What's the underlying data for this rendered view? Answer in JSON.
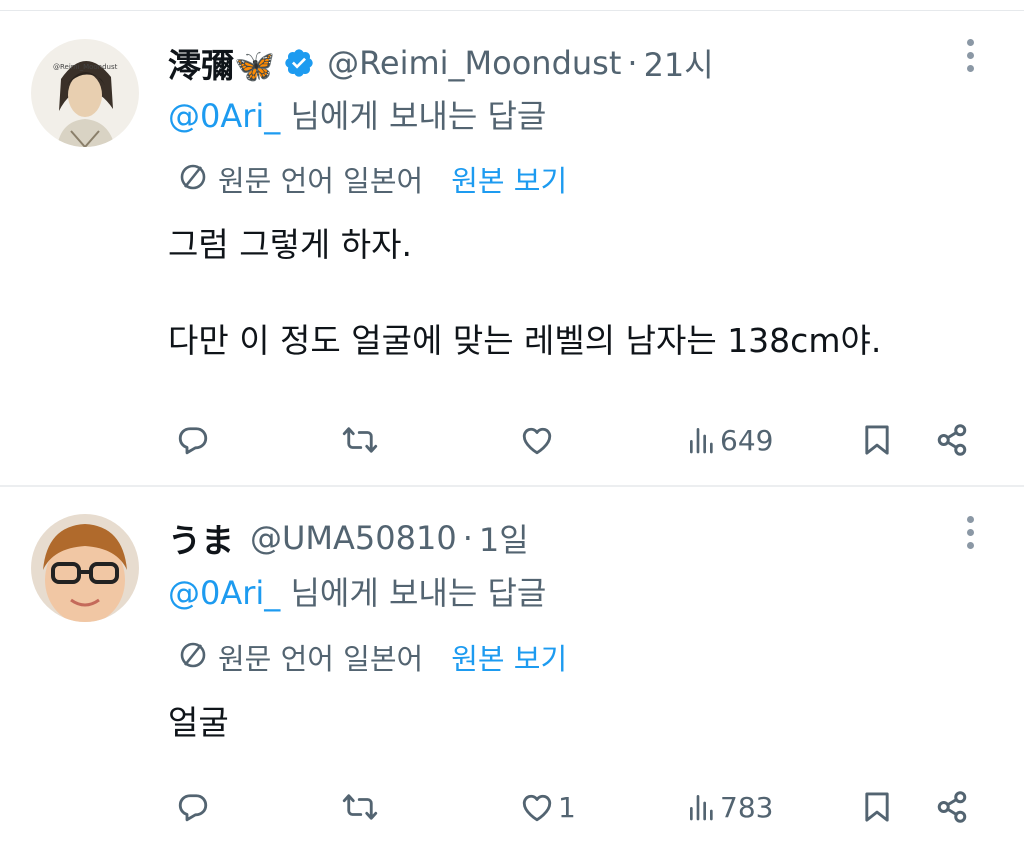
{
  "tweets": [
    {
      "name": "澪彌🦋",
      "handle": "@Reimi_Moondust",
      "time": "21시",
      "reply_mention": "@0Ari_",
      "reply_suffix": " 님에게 보내는 답글",
      "translate_note": "원문 언어 일본어",
      "translate_link": "원본 보기",
      "body": "그럼 그렇게 하자.\n\n다만 이 정도 얼굴에 맞는 레벨의 남자는 138cm야.",
      "likes": "",
      "views": "649",
      "verified": true
    },
    {
      "name": "うま",
      "handle": "@UMA50810",
      "time": "1일",
      "reply_mention": "@0Ari_",
      "reply_suffix": " 님에게 보내는 답글",
      "translate_note": "원문 언어 일본어",
      "translate_link": "원본 보기",
      "body": "얼굴",
      "likes": "1",
      "views": "783",
      "verified": false
    }
  ],
  "colors": {
    "accent": "#1d9bf0",
    "secondary_text": "#536471",
    "primary_text": "#0f1419"
  },
  "icons": [
    "verified-badge-icon",
    "more-icon",
    "translate-icon",
    "reply-icon",
    "retweet-icon",
    "like-icon",
    "views-icon",
    "bookmark-icon",
    "share-icon"
  ]
}
